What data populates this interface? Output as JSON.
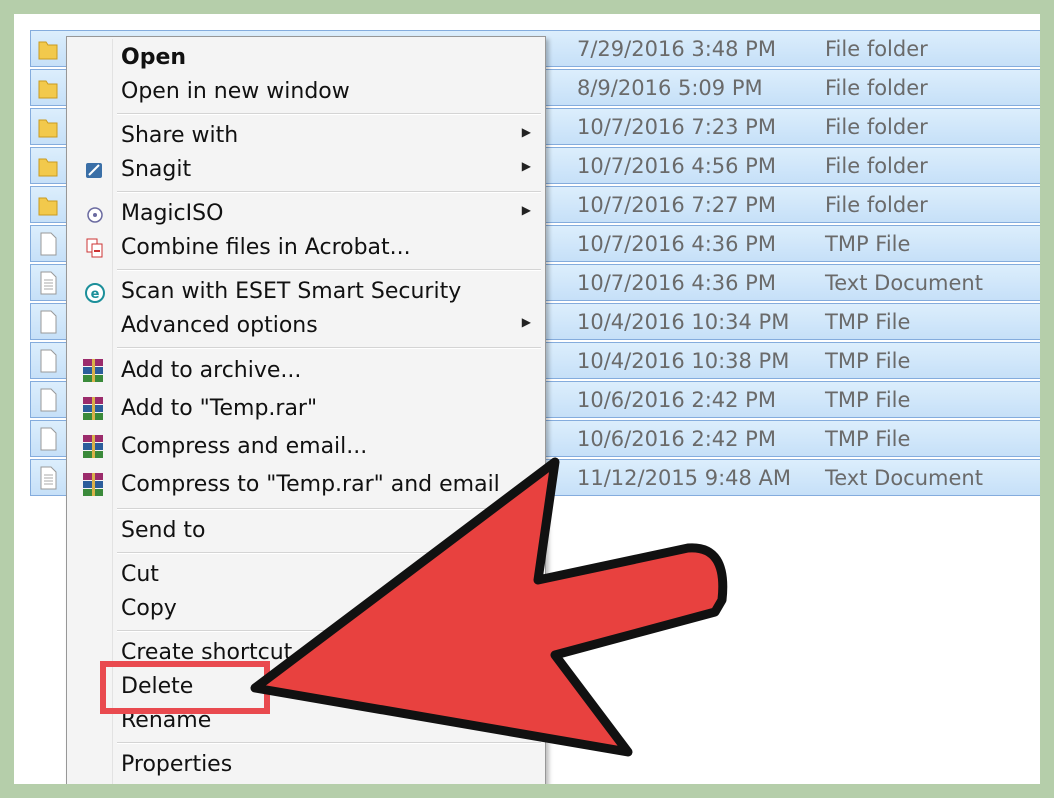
{
  "file_rows": [
    {
      "kind": "folder",
      "date": "7/29/2016 3:48 PM",
      "type": "File folder"
    },
    {
      "kind": "folder",
      "date": "8/9/2016 5:09 PM",
      "type": "File folder"
    },
    {
      "kind": "folder",
      "date": "10/7/2016 7:23 PM",
      "type": "File folder"
    },
    {
      "kind": "folder",
      "date": "10/7/2016 4:56 PM",
      "type": "File folder"
    },
    {
      "kind": "folder",
      "date": "10/7/2016 7:27 PM",
      "type": "File folder"
    },
    {
      "kind": "file",
      "date": "10/7/2016 4:36 PM",
      "type": "TMP File"
    },
    {
      "kind": "text",
      "date": "10/7/2016 4:36 PM",
      "type": "Text Document"
    },
    {
      "kind": "file",
      "date": "10/4/2016 10:34 PM",
      "type": "TMP File"
    },
    {
      "kind": "file",
      "date": "10/4/2016 10:38 PM",
      "type": "TMP File"
    },
    {
      "kind": "file",
      "date": "10/6/2016 2:42 PM",
      "type": "TMP File"
    },
    {
      "kind": "file",
      "date": "10/6/2016 2:42 PM",
      "type": "TMP File"
    },
    {
      "kind": "text",
      "date": "11/12/2015 9:48 AM",
      "type": "Text Document"
    }
  ],
  "context_menu": {
    "open": "Open",
    "open_new_window": "Open in new window",
    "share_with": "Share with",
    "snagit": "Snagit",
    "magiciso": "MagicISO",
    "combine_acrobat": "Combine files in Acrobat...",
    "scan_eset": "Scan with ESET Smart Security",
    "advanced_options": "Advanced options",
    "add_to_archive": "Add to archive...",
    "add_to_temp_rar": "Add to \"Temp.rar\"",
    "compress_email": "Compress and email...",
    "compress_temp_email": "Compress to \"Temp.rar\" and email",
    "send_to": "Send to",
    "cut": "Cut",
    "copy": "Copy",
    "create_shortcut": "Create shortcut",
    "delete": "Delete",
    "rename": "Rename",
    "properties": "Properties"
  },
  "icons": {
    "folder": "folder-icon",
    "file": "file-icon",
    "text": "text-document-icon",
    "snagit": "snagit-icon",
    "magiciso": "magiciso-icon",
    "acrobat": "acrobat-icon",
    "eset": "eset-icon",
    "winrar": "winrar-icon",
    "submenu": "chevron-right-icon"
  },
  "colors": {
    "frame": "#b5ceaa",
    "selection": "#c6e0f8",
    "annotation_red": "#e94a4f",
    "arrow_fill": "#e8413f"
  }
}
